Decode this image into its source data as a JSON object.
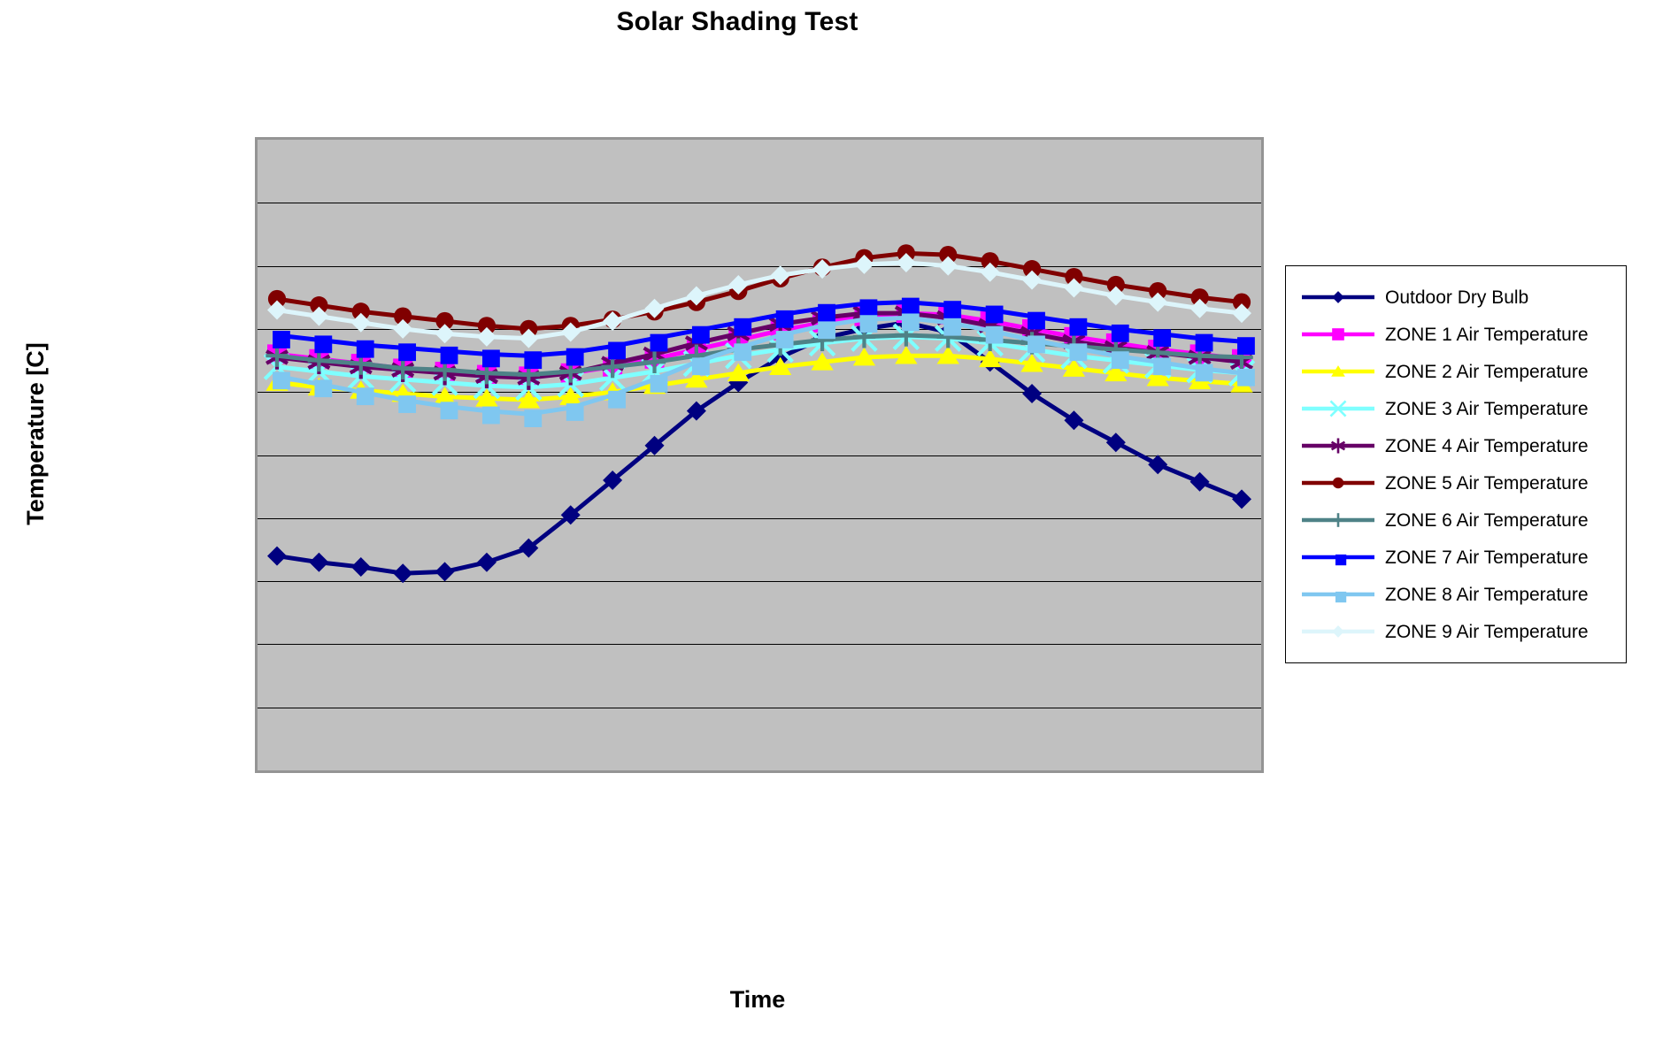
{
  "chart_data": {
    "type": "line",
    "title": "Solar Shading Test",
    "xlabel": "Time",
    "ylabel": "Temperature [C]",
    "grid": true,
    "legend_position": "right",
    "plot_background": "#C0C0C0",
    "plot_border_color": "#949494",
    "gridline_color": "#000000",
    "gridline_count": 9,
    "axis_tick_labels_visible": false,
    "x": [
      1,
      2,
      3,
      4,
      5,
      6,
      7,
      8,
      9,
      10,
      11,
      12,
      13,
      14,
      15,
      16,
      17,
      18,
      19,
      20,
      21,
      22,
      23,
      24
    ],
    "ylim": [
      0,
      40
    ],
    "xlim": [
      1,
      24
    ],
    "series": [
      {
        "name": "Outdoor Dry Bulb",
        "color": "#000080",
        "marker": "diamond",
        "values": [
          13.6,
          13.2,
          12.9,
          12.5,
          12.6,
          13.2,
          14.1,
          16.2,
          18.4,
          20.6,
          22.8,
          24.6,
          26.2,
          27.4,
          28.0,
          28.4,
          27.8,
          25.9,
          23.9,
          22.2,
          20.8,
          19.4,
          18.3,
          17.2
        ]
      },
      {
        "name": "ZONE 1 Air Temperature",
        "color": "#FF00FF",
        "marker": "square",
        "values": [
          26.4,
          26.1,
          25.8,
          25.5,
          25.3,
          25.1,
          25.0,
          25.2,
          25.6,
          26.1,
          26.7,
          27.3,
          27.9,
          28.4,
          28.8,
          29.0,
          28.9,
          28.5,
          28.0,
          27.5,
          27.1,
          26.7,
          26.4,
          26.1
        ]
      },
      {
        "name": "ZONE 2 Air Temperature",
        "color": "#FFFF00",
        "marker": "triangle",
        "values": [
          24.6,
          24.3,
          24.1,
          23.9,
          23.7,
          23.6,
          23.5,
          23.7,
          24.0,
          24.4,
          24.8,
          25.2,
          25.6,
          25.9,
          26.2,
          26.3,
          26.3,
          26.1,
          25.8,
          25.5,
          25.2,
          24.9,
          24.7,
          24.5
        ]
      },
      {
        "name": "ZONE 3 Air Temperature",
        "color": "#7FFFFF",
        "marker": "cross-x",
        "values": [
          25.6,
          25.3,
          25.0,
          24.8,
          24.6,
          24.4,
          24.3,
          24.5,
          24.9,
          25.3,
          25.8,
          26.3,
          26.7,
          27.1,
          27.4,
          27.5,
          27.4,
          27.1,
          26.7,
          26.3,
          26.0,
          25.7,
          25.4,
          25.2
        ]
      },
      {
        "name": "ZONE 4 Air Temperature",
        "color": "#660066",
        "marker": "asterisk",
        "values": [
          26.2,
          25.9,
          25.6,
          25.4,
          25.2,
          25.0,
          24.9,
          25.2,
          25.8,
          26.4,
          27.1,
          27.7,
          28.3,
          28.7,
          29.0,
          29.0,
          28.7,
          28.2,
          27.7,
          27.2,
          26.8,
          26.5,
          26.2,
          25.9
        ]
      },
      {
        "name": "ZONE 5 Air Temperature",
        "color": "#800000",
        "marker": "circle",
        "values": [
          29.9,
          29.5,
          29.1,
          28.8,
          28.5,
          28.2,
          28.0,
          28.2,
          28.6,
          29.1,
          29.7,
          30.4,
          31.2,
          31.9,
          32.5,
          32.8,
          32.7,
          32.3,
          31.8,
          31.3,
          30.8,
          30.4,
          30.0,
          29.7
        ]
      },
      {
        "name": "ZONE 6 Air Temperature",
        "color": "#4E8287",
        "marker": "plus",
        "values": [
          26.3,
          26.0,
          25.8,
          25.5,
          25.4,
          25.2,
          25.1,
          25.3,
          25.6,
          25.9,
          26.3,
          26.7,
          27.0,
          27.3,
          27.5,
          27.6,
          27.5,
          27.3,
          27.1,
          26.9,
          26.7,
          26.5,
          26.3,
          26.2
        ]
      },
      {
        "name": "ZONE 7 Air Temperature",
        "color": "#0000FF",
        "marker": "small-square",
        "values": [
          27.6,
          27.3,
          27.0,
          26.8,
          26.6,
          26.4,
          26.3,
          26.5,
          26.9,
          27.4,
          27.9,
          28.4,
          28.9,
          29.3,
          29.6,
          29.7,
          29.5,
          29.2,
          28.8,
          28.4,
          28.0,
          27.7,
          27.4,
          27.2
        ]
      },
      {
        "name": "ZONE 8 Air Temperature",
        "color": "#7FC7F0",
        "marker": "small-square",
        "values": [
          25.0,
          24.5,
          24.0,
          23.5,
          23.1,
          22.8,
          22.6,
          23.0,
          23.8,
          24.8,
          25.9,
          26.8,
          27.6,
          28.2,
          28.6,
          28.7,
          28.4,
          27.9,
          27.3,
          26.8,
          26.3,
          25.9,
          25.5,
          25.2
        ]
      },
      {
        "name": "ZONE 9 Air Temperature",
        "color": "#DDF5FB",
        "marker": "diamond",
        "values": [
          29.2,
          28.8,
          28.4,
          28.0,
          27.7,
          27.5,
          27.4,
          27.8,
          28.5,
          29.3,
          30.1,
          30.8,
          31.4,
          31.8,
          32.1,
          32.2,
          32.0,
          31.6,
          31.1,
          30.6,
          30.1,
          29.7,
          29.3,
          29.0
        ]
      }
    ]
  },
  "title": {
    "text": "Solar Shading Test"
  },
  "axes": {
    "y_title": "Temperature [C]",
    "x_title": "Time"
  },
  "legend": {
    "items": [
      {
        "label": "Outdoor Dry Bulb",
        "color": "#000080",
        "marker": "diamond"
      },
      {
        "label": "ZONE 1 Air Temperature",
        "color": "#FF00FF",
        "marker": "square"
      },
      {
        "label": "ZONE 2 Air Temperature",
        "color": "#FFFF00",
        "marker": "triangle"
      },
      {
        "label": "ZONE 3 Air Temperature",
        "color": "#7FFFFF",
        "marker": "cross-x"
      },
      {
        "label": "ZONE 4 Air Temperature",
        "color": "#660066",
        "marker": "asterisk"
      },
      {
        "label": "ZONE 5 Air Temperature",
        "color": "#800000",
        "marker": "circle"
      },
      {
        "label": "ZONE 6 Air Temperature",
        "color": "#4E8287",
        "marker": "plus"
      },
      {
        "label": "ZONE 7 Air Temperature",
        "color": "#0000FF",
        "marker": "small-square"
      },
      {
        "label": "ZONE 8 Air Temperature",
        "color": "#7FC7F0",
        "marker": "small-square"
      },
      {
        "label": "ZONE 9 Air Temperature",
        "color": "#DDF5FB",
        "marker": "diamond"
      }
    ]
  }
}
